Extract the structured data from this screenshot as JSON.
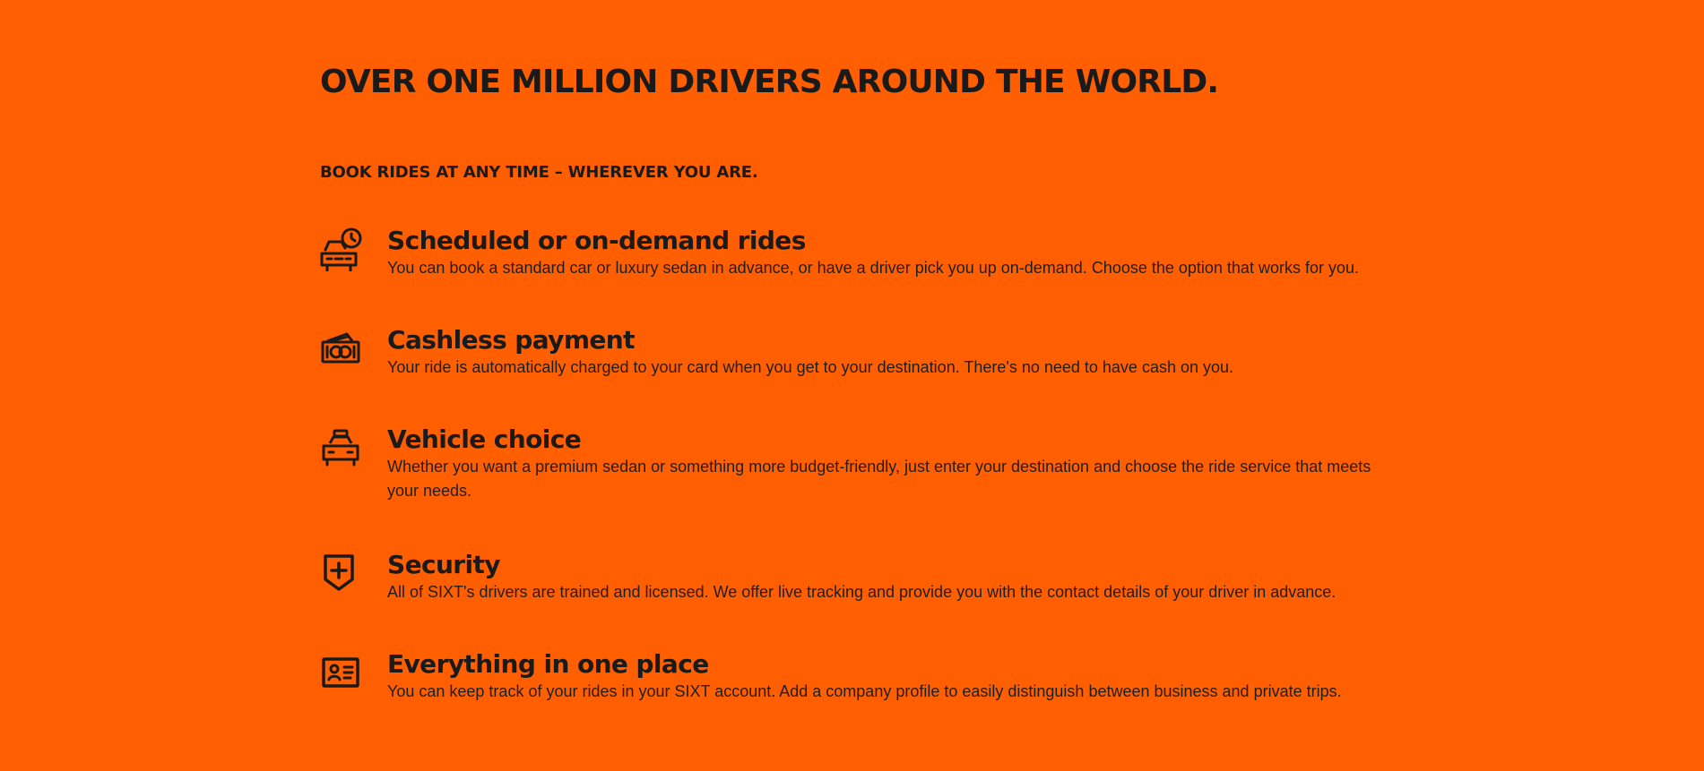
{
  "page": {
    "headline": "OVER ONE MILLION DRIVERS AROUND THE WORLD.",
    "subheadline": "BOOK RIDES AT ANY TIME – WHEREVER YOU ARE.",
    "background_color": "#ff5f00",
    "text_color": "#1a1a1a"
  },
  "features": [
    {
      "icon": "scheduled-car-icon",
      "title": "Scheduled or on-demand rides",
      "description": "You can book a standard car or luxury sedan in advance, or have a driver pick you up on-demand. Choose the option that works for you."
    },
    {
      "icon": "cash-payment-icon",
      "title": "Cashless payment",
      "description": "Your ride is automatically charged to your card when you get to your destination. There's no need to have cash on you."
    },
    {
      "icon": "taxi-icon",
      "title": "Vehicle choice",
      "description": "Whether you want a premium sedan or something more budget-friendly, just enter your destination and choose the ride service that meets your needs."
    },
    {
      "icon": "shield-plus-icon",
      "title": "Security",
      "description": "All of SIXT's drivers are trained and licensed. We offer live tracking and provide you with the contact details of your driver in advance."
    },
    {
      "icon": "id-card-icon",
      "title": "Everything in one place",
      "description": "You can keep track of your rides in your SIXT account. Add a company profile to easily distinguish between business and private trips."
    }
  ]
}
